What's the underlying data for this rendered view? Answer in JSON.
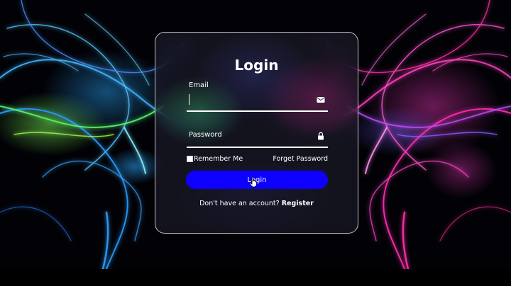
{
  "login": {
    "title": "Login",
    "email_label": "Email",
    "password_label": "Password",
    "remember_label": "Remember Me",
    "forgot_label": "Forget Password",
    "button_label": "Login",
    "register_prompt": "Don't have an account?",
    "register_link": "Register",
    "email_icon": "envelope-icon",
    "password_icon": "lock-icon"
  },
  "colors": {
    "button": "#0d00ff",
    "left_glow": "#2fa0ff",
    "right_glow": "#ff2fb8"
  }
}
